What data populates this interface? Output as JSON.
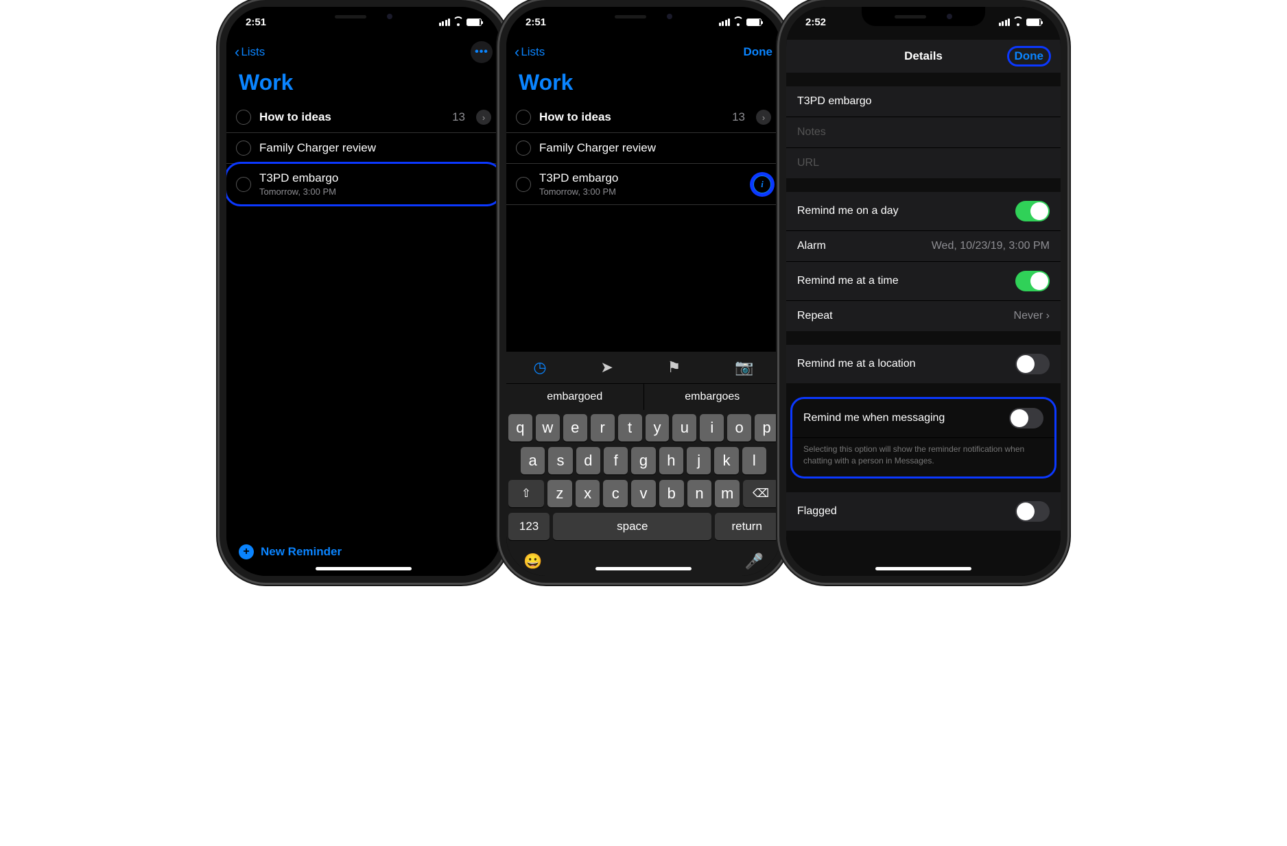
{
  "status": {
    "t1": "2:51",
    "t2": "2:51",
    "t3": "2:52"
  },
  "p1": {
    "back": "Lists",
    "title": "Work",
    "rows": [
      {
        "name": "How to ideas",
        "count": "13",
        "bold": true,
        "disclosure": true
      },
      {
        "name": "Family Charger review"
      },
      {
        "name": "T3PD embargo",
        "sub": "Tomorrow, 3:00 PM",
        "hi": true
      }
    ],
    "new": "New Reminder"
  },
  "p2": {
    "back": "Lists",
    "done": "Done",
    "title": "Work",
    "rows": [
      {
        "name": "How to ideas",
        "count": "13",
        "bold": true,
        "disclosure": true
      },
      {
        "name": "Family Charger review"
      },
      {
        "name": "T3PD embargo",
        "sub": "Tomorrow, 3:00 PM",
        "info": true
      }
    ],
    "suggest": [
      "embargoed",
      "embargoes"
    ],
    "kbrows": [
      [
        "q",
        "w",
        "e",
        "r",
        "t",
        "y",
        "u",
        "i",
        "o",
        "p"
      ],
      [
        "a",
        "s",
        "d",
        "f",
        "g",
        "h",
        "j",
        "k",
        "l"
      ],
      [
        "z",
        "x",
        "c",
        "v",
        "b",
        "n",
        "m"
      ]
    ],
    "kbfn": {
      "shift": "⇧",
      "del": "⌫",
      "num": "123",
      "space": "space",
      "ret": "return"
    }
  },
  "p3": {
    "header": "Details",
    "done": "Done",
    "itemTitle": "T3PD embargo",
    "notes": "Notes",
    "url": "URL",
    "remindDay": "Remind me on a day",
    "alarm": "Alarm",
    "alarmVal": "Wed, 10/23/19, 3:00 PM",
    "remindTime": "Remind me at a time",
    "repeat": "Repeat",
    "repeatVal": "Never",
    "remindLoc": "Remind me at a location",
    "remindMsg": "Remind me when messaging",
    "msgFoot": "Selecting this option will show the reminder notification when chatting with a person in Messages.",
    "flagged": "Flagged"
  }
}
